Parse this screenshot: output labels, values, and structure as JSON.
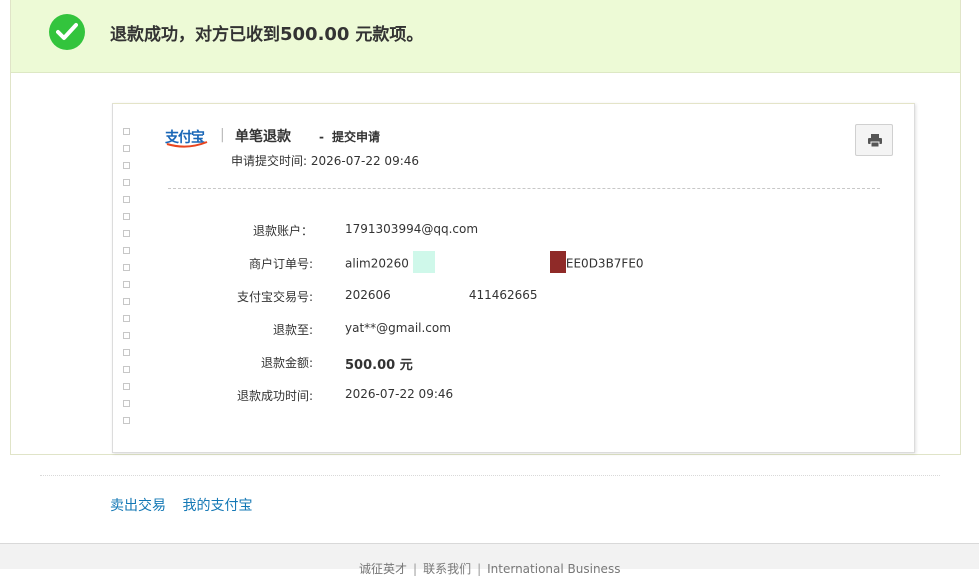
{
  "banner": {
    "text_prefix": "退款成功，对方已收到",
    "amount": "500.00",
    "text_suffix": " 元款项。"
  },
  "receipt": {
    "logo_text": "支付宝",
    "separator": "|",
    "title": "单笔退款",
    "dash": "-",
    "subtitle": "提交申请",
    "apply_time_label": "申请提交时间:",
    "apply_time": "2026-07-22 09:46",
    "rows": [
      {
        "label": "退款账户：",
        "value": "1791303994@qq.com"
      },
      {
        "label": "商户订单号:",
        "value_a": "alim20260",
        "value_b": "EE0D3B7FE0"
      },
      {
        "label": "支付宝交易号:",
        "value_a": "202606",
        "value_b": "411462665"
      },
      {
        "label": "退款至:",
        "value": "yat**@gmail.com"
      },
      {
        "label": "退款金额:",
        "value": "500.00 元"
      },
      {
        "label": "退款成功时间:",
        "value": "2026-07-22 09:46"
      }
    ]
  },
  "links": {
    "sold": "卖出交易",
    "my_alipay": "我的支付宝"
  },
  "footer": {
    "item1": "诚征英才",
    "item2": "联系我们",
    "item3": "International Business",
    "pipe": "|"
  },
  "colors": {
    "banner_bg": "#edfad6",
    "success_green": "#33c43d",
    "link_blue": "#1478b5",
    "mask_cyan": "#cff8ea",
    "mask_red": "#8f2a28"
  }
}
